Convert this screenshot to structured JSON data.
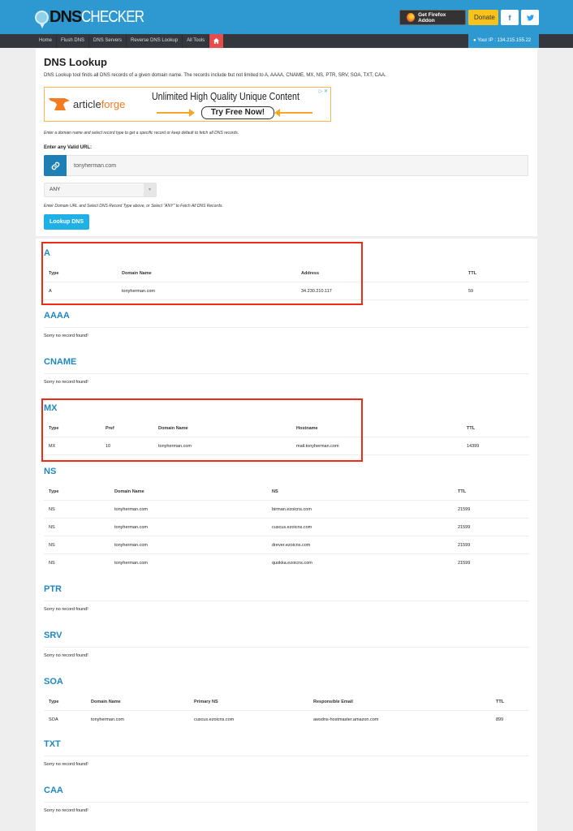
{
  "header": {
    "logo_dns": "DNS",
    "logo_checker": "CHECKER",
    "firefox_label": "Get Firefox Addon",
    "donate_label": "Donate",
    "facebook_glyph": "f",
    "twitter_glyph": "🐦"
  },
  "nav": {
    "items": [
      "Home",
      "Flush DNS",
      "DNS Servers",
      "Reverse DNS Lookup",
      "All Tools"
    ],
    "ip_label": "Your IP : 134.215.155.22"
  },
  "page": {
    "title": "DNS Lookup",
    "description": "DNS Lookup tool finds all DNS records of a given domain name. The records include but not limited to A, AAAA, CNAME, MX, NS, PTR, SRV, SOA, TXT, CAA."
  },
  "ad": {
    "brand_a": "article",
    "brand_b": "forge",
    "headline": "Unlimited High Quality Unique Content",
    "cta": "Try Free Now!",
    "adchoices": "▷ ✕"
  },
  "form": {
    "hint": "Enter a domain name and select record type to get a specific record or keep default to fetch all DNS records.",
    "url_label": "Enter any Valid URL:",
    "url_value": "tonyherman.com",
    "record_type": "ANY",
    "select_hint": "Enter Domain URL and Select DNS Record Type above, or Select \"ANY\" to Fetch All DNS Records.",
    "submit_label": "Lookup DNS"
  },
  "no_record_text": "Sorry no record found!",
  "results": {
    "A": {
      "title": "A",
      "headers": [
        "Type",
        "Domain Name",
        "Address",
        "TTL"
      ],
      "rows": [
        [
          "A",
          "tonyherman.com",
          "34.230.210.117",
          "59"
        ]
      ]
    },
    "AAAA": {
      "title": "AAAA"
    },
    "CNAME": {
      "title": "CNAME"
    },
    "MX": {
      "title": "MX",
      "headers": [
        "Type",
        "Pref",
        "Domain Name",
        "Hostname",
        "TTL"
      ],
      "rows": [
        [
          "MX",
          "10",
          "tonyherman.com",
          "mail.tonyherman.com",
          "14399"
        ]
      ]
    },
    "NS": {
      "title": "NS",
      "headers": [
        "Type",
        "Domain Name",
        "NS",
        "TTL"
      ],
      "rows": [
        [
          "NS",
          "tonyherman.com",
          "birman.ezoicns.com",
          "21599"
        ],
        [
          "NS",
          "tonyherman.com",
          "cuscus.ezoicns.com",
          "21599"
        ],
        [
          "NS",
          "tonyherman.com",
          "drever.ezoicns.com",
          "21599"
        ],
        [
          "NS",
          "tonyherman.com",
          "quokka.ezoicns.com",
          "21599"
        ]
      ]
    },
    "PTR": {
      "title": "PTR"
    },
    "SRV": {
      "title": "SRV"
    },
    "SOA": {
      "title": "SOA",
      "headers": [
        "Type",
        "Domain Name",
        "Primary NS",
        "Responsible Email",
        "TTL"
      ],
      "rows": [
        [
          "SOA",
          "tonyherman.com",
          "cuscus.ezoicns.com",
          "awsdns-hostmaster.amazon.com",
          "899"
        ]
      ]
    },
    "TXT": {
      "title": "TXT"
    },
    "CAA": {
      "title": "CAA"
    }
  },
  "colors": {
    "brand_blue": "#2e99d0",
    "nav_dark": "#34373d",
    "section_title": "#1e87c2",
    "donate": "#f8c21c",
    "lookup_button": "#1fb0e6",
    "highlight": "#f02a14"
  }
}
